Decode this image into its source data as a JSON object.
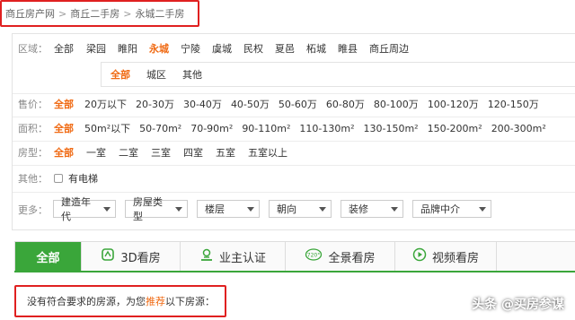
{
  "breadcrumb": [
    "商丘房产网",
    "商丘二手房",
    "永城二手房"
  ],
  "filters": {
    "district": {
      "label": "区域：",
      "options": [
        "全部",
        "梁园",
        "睢阳",
        "永城",
        "宁陵",
        "虞城",
        "民权",
        "夏邑",
        "柘城",
        "睢县",
        "商丘周边"
      ],
      "active": 3
    },
    "subdistrict": {
      "options": [
        "全部",
        "城区",
        "其他"
      ],
      "active": 0
    },
    "price": {
      "label": "售价：",
      "options": [
        "全部",
        "20万以下",
        "20-30万",
        "30-40万",
        "40-50万",
        "50-60万",
        "60-80万",
        "80-100万",
        "100-120万",
        "120-150万"
      ],
      "active": 0
    },
    "area": {
      "label": "面积：",
      "options": [
        "全部",
        "50m²以下",
        "50-70m²",
        "70-90m²",
        "90-110m²",
        "110-130m²",
        "130-150m²",
        "150-200m²",
        "200-300m²"
      ],
      "active": 0
    },
    "rooms": {
      "label": "房型：",
      "options": [
        "全部",
        "一室",
        "二室",
        "三室",
        "四室",
        "五室",
        "五室以上"
      ],
      "active": 0
    },
    "other": {
      "label": "其他：",
      "checkbox_label": "有电梯"
    },
    "more": {
      "label": "更多：",
      "selects": [
        "建造年代",
        "房屋类型",
        "楼层",
        "朝向",
        "装修",
        "品牌中介"
      ]
    }
  },
  "tabs": [
    "全部",
    "3D看房",
    "业主认证",
    "全景看房",
    "视频看房"
  ],
  "notice": {
    "prefix": "没有符合要求的房源，为您",
    "highlight": "推荐",
    "suffix": "以下房源："
  },
  "watermark": "头条 @买房参谋",
  "colors": {
    "accent": "#f06a13",
    "tab_green": "#3aa63a",
    "highlight_red": "#e02020"
  }
}
